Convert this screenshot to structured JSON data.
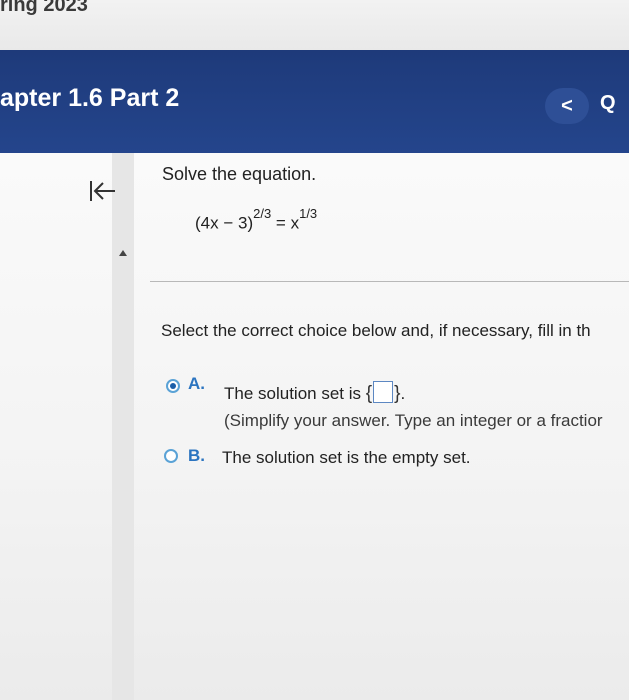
{
  "course": {
    "title": "ring 2023"
  },
  "header": {
    "chapter_title": "apter 1.6 Part 2",
    "prev_label": "<",
    "next_label": "Q"
  },
  "question": {
    "prompt": "Solve the equation.",
    "equation": {
      "base": "(4x − 3)",
      "exponent_left": "2/3",
      "equals": "=",
      "variable": "x",
      "exponent_right": "1/3"
    },
    "instruction": "Select the correct choice below and, if necessary, fill in th",
    "choices": [
      {
        "letter": "A.",
        "text_before": "The solution set is",
        "brace_open": "{",
        "brace_close": "}",
        "text_after": ".",
        "hint": "(Simplify your answer. Type an integer or a fractior",
        "selected": true
      },
      {
        "letter": "B.",
        "text": "The solution set is the empty set.",
        "selected": false
      }
    ]
  },
  "icons": {
    "collapse": "collapse-left-icon",
    "scroll_up": "up-arrow-icon"
  },
  "colors": {
    "header_bg": "#1e3a7a",
    "radio_accent": "#5aa2d6",
    "choice_letter": "#2b74c0"
  }
}
